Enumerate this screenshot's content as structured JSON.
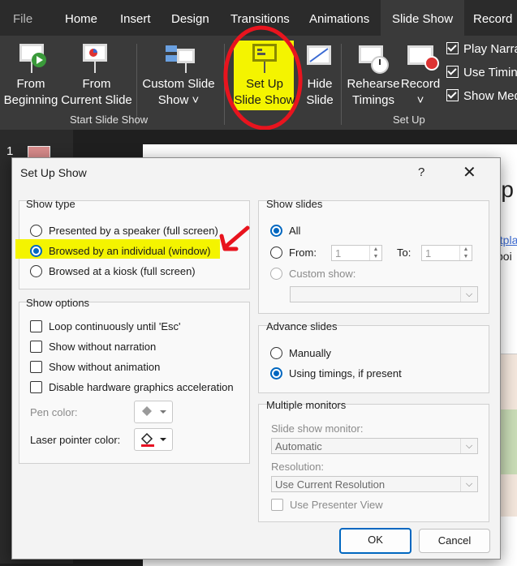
{
  "ribbon": {
    "tabs": [
      "File",
      "Home",
      "Insert",
      "Design",
      "Transitions",
      "Animations",
      "Slide Show",
      "Record"
    ],
    "buttons": {
      "from_beginning": [
        "From",
        "Beginning"
      ],
      "from_current": [
        "From",
        "Current Slide"
      ],
      "custom_slide_show": [
        "Custom Slide",
        "Show ˅"
      ],
      "set_up_slide_show": [
        "Set Up",
        "Slide Show"
      ],
      "hide_slide": [
        "Hide",
        "Slide"
      ],
      "rehearse_timings": [
        "Rehearse",
        "Timings"
      ],
      "record": [
        "Record",
        "˅"
      ]
    },
    "groups": [
      "Start Slide Show",
      "Set Up"
    ],
    "checks": [
      "Play Narra",
      "Use Timin",
      "Show Med"
    ]
  },
  "slide_panel": {
    "slide_number": "1"
  },
  "slide_bg_text": {
    "t1": "s-p",
    "t2": "ntpla",
    "t3": "poi"
  },
  "dialog": {
    "title": "Set Up Show",
    "help": "?",
    "close": "✕",
    "show_type": {
      "label": "Show type",
      "options": [
        "Presented by a speaker (full screen)",
        "Browsed by an individual (window)",
        "Browsed at a kiosk (full screen)"
      ],
      "selected": 1
    },
    "show_options": {
      "label": "Show options",
      "checks": [
        "Loop continuously until 'Esc'",
        "Show without narration",
        "Show without animation",
        "Disable hardware graphics acceleration"
      ],
      "pen_color": "Pen color:",
      "laser_color": "Laser pointer color:",
      "laser_swatch": "#e81123"
    },
    "show_slides": {
      "label": "Show slides",
      "all": "All",
      "from": "From:",
      "from_value": "1",
      "to": "To:",
      "to_value": "1",
      "custom_show": "Custom show:"
    },
    "advance_slides": {
      "label": "Advance slides",
      "manually": "Manually",
      "using_timings": "Using timings, if present"
    },
    "multiple_monitors": {
      "label": "Multiple monitors",
      "monitor_label": "Slide show monitor:",
      "monitor_value": "Automatic",
      "resolution_label": "Resolution:",
      "resolution_value": "Use Current Resolution",
      "presenter_view": "Use Presenter View"
    },
    "ok": "OK",
    "cancel": "Cancel"
  },
  "annotation_colors": {
    "highlight": "#f4f400",
    "circle": "#e8141e",
    "arrow": "#e8141e"
  }
}
